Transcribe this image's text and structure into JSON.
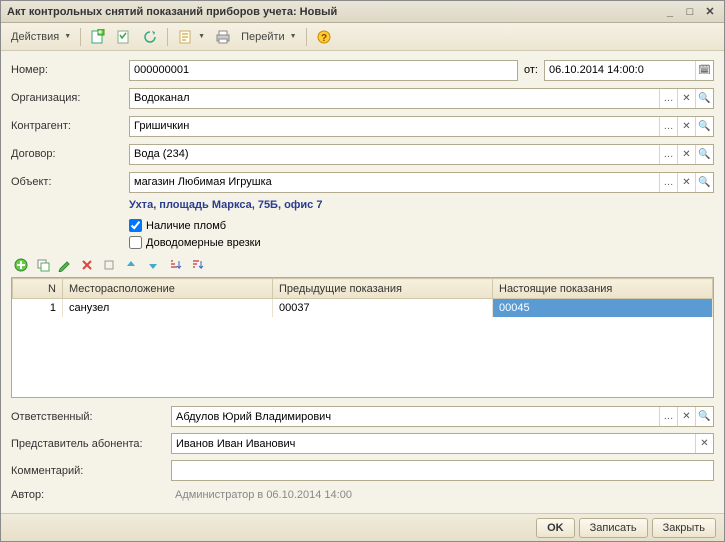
{
  "window": {
    "title": "Акт контрольных снятий показаний приборов учета: Новый"
  },
  "toolbar": {
    "actions": "Действия",
    "goto": "Перейти"
  },
  "form": {
    "number_label": "Номер:",
    "number_value": "000000001",
    "from_label": "от:",
    "date_value": "06.10.2014 14:00:0",
    "org_label": "Организация:",
    "org_value": "Водоканал",
    "contractor_label": "Контрагент:",
    "contractor_value": "Гришичкин",
    "contract_label": "Договор:",
    "contract_value": "Вода (234)",
    "object_label": "Объект:",
    "object_value": "магазин Любимая Игрушка",
    "address": "Ухта, площадь Маркса, 75Б, офис 7",
    "seal_label": "Наличие пломб",
    "illegal_label": "Доводомерные врезки"
  },
  "grid": {
    "headers": {
      "n": "N",
      "location": "Месторасположение",
      "prev": "Предыдущие показания",
      "curr": "Настоящие показания"
    },
    "rows": [
      {
        "n": "1",
        "location": "санузел",
        "prev": "00037",
        "curr": "00045"
      }
    ]
  },
  "bottom": {
    "resp_label": "Ответственный:",
    "resp_value": "Абдулов Юрий Владимирович",
    "rep_label": "Представитель абонента:",
    "rep_value": "Иванов Иван Иванович",
    "comment_label": "Комментарий:",
    "comment_value": "",
    "author_label": "Автор:",
    "author_value": "Администратор в 06.10.2014 14:00"
  },
  "footer": {
    "ok": "OK",
    "save": "Записать",
    "close": "Закрыть"
  }
}
